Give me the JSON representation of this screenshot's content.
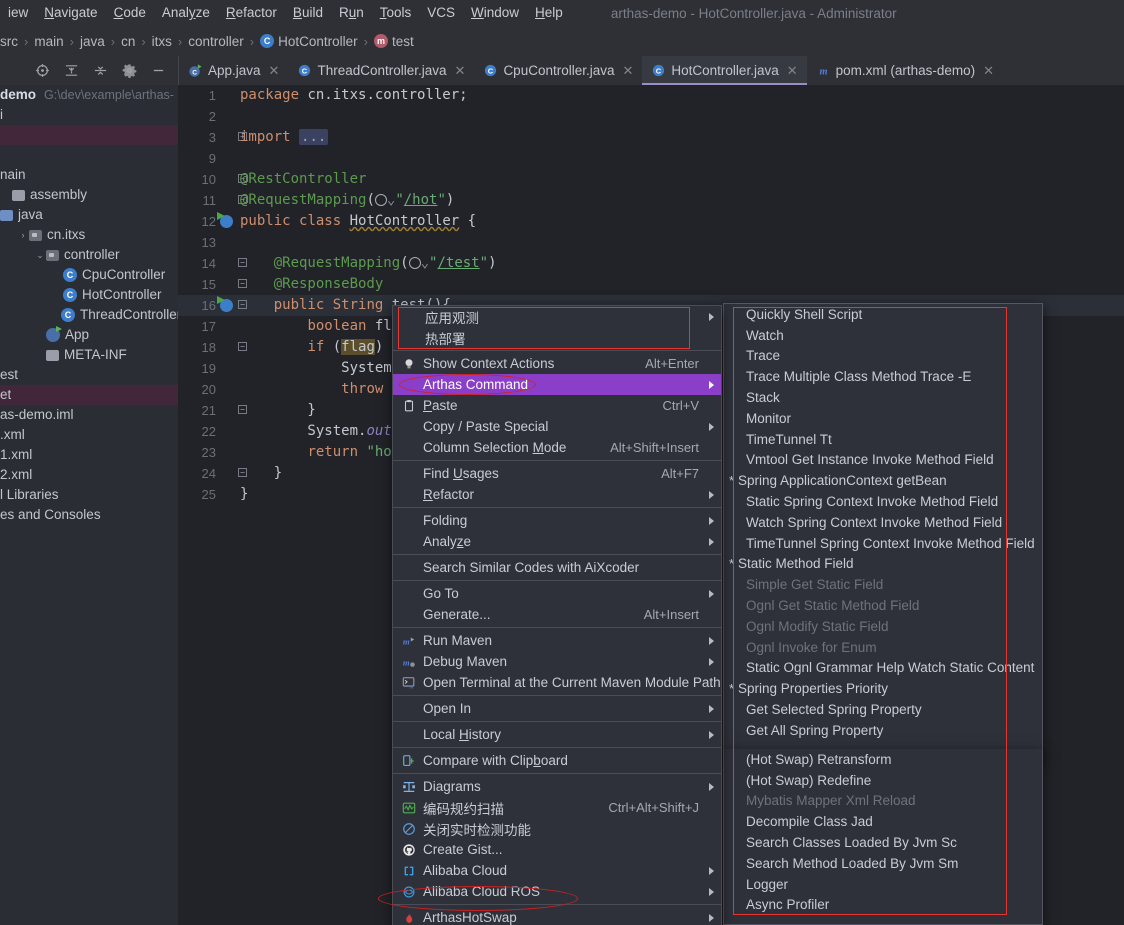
{
  "menubar": {
    "items": [
      "iew",
      "Navigate",
      "Code",
      "Analyze",
      "Refactor",
      "Build",
      "Run",
      "Tools",
      "VCS",
      "Window",
      "Help"
    ],
    "window_title": "arthas-demo - HotController.java - Administrator"
  },
  "breadcrumb": {
    "items": [
      {
        "label": "src",
        "icon": ""
      },
      {
        "label": "main",
        "icon": ""
      },
      {
        "label": "java",
        "icon": ""
      },
      {
        "label": "cn",
        "icon": ""
      },
      {
        "label": "itxs",
        "icon": ""
      },
      {
        "label": "controller",
        "icon": ""
      },
      {
        "label": "HotController",
        "icon": "class-icon"
      },
      {
        "label": "test",
        "icon": "method-icon"
      }
    ]
  },
  "toolbar": {
    "icons": [
      "locate-target-icon",
      "expand-all-icon",
      "collapse-all-icon",
      "settings-gear-icon",
      "hide-minus-icon"
    ]
  },
  "tabs": [
    {
      "label": "App.java",
      "icon": "app-run-icon",
      "active": false
    },
    {
      "label": "ThreadController.java",
      "icon": "class-icon",
      "active": false
    },
    {
      "label": "CpuController.java",
      "icon": "class-icon",
      "active": false
    },
    {
      "label": "HotController.java",
      "icon": "class-icon",
      "active": true
    },
    {
      "label": "pom.xml (arthas-demo)",
      "icon": "maven-icon",
      "active": false
    }
  ],
  "sidebar": {
    "rows": [
      {
        "label": "demo",
        "path": "G:\\dev\\example\\arthas-",
        "kind": "project",
        "bold": true,
        "indent": 0
      },
      {
        "label": "i",
        "kind": "text",
        "indent": 0
      },
      {
        "label": "",
        "kind": "blank-highlight",
        "indent": 0,
        "highlight": true
      },
      {
        "label": "",
        "kind": "blank",
        "indent": 0
      },
      {
        "label": "nain",
        "kind": "text",
        "indent": 0
      },
      {
        "label": "assembly",
        "kind": "folder",
        "indent": 0
      },
      {
        "label": "java",
        "kind": "source-folder",
        "indent": 0
      },
      {
        "label": "cn.itxs",
        "kind": "package",
        "indent": 1,
        "chevron": "right"
      },
      {
        "label": "controller",
        "kind": "package",
        "indent": 2,
        "chevron": "down"
      },
      {
        "label": "CpuController",
        "kind": "class",
        "indent": 3
      },
      {
        "label": "HotController",
        "kind": "class",
        "indent": 3
      },
      {
        "label": "ThreadController",
        "kind": "class",
        "indent": 3
      },
      {
        "label": "App",
        "kind": "app",
        "indent": 2
      },
      {
        "label": "META-INF",
        "kind": "folder",
        "indent": 2
      },
      {
        "label": "est",
        "kind": "text",
        "indent": 0
      },
      {
        "label": "et",
        "kind": "text",
        "indent": 0,
        "highlight": true
      },
      {
        "label": "as-demo.iml",
        "kind": "text",
        "indent": 0
      },
      {
        "label": ".xml",
        "kind": "text",
        "indent": 0
      },
      {
        "label": "1.xml",
        "kind": "text",
        "indent": 0
      },
      {
        "label": "2.xml",
        "kind": "text",
        "indent": 0
      },
      {
        "label": "l Libraries",
        "kind": "text",
        "indent": 0
      },
      {
        "label": "es and Consoles",
        "kind": "text",
        "indent": 0
      }
    ]
  },
  "editor": {
    "lines": [
      {
        "no": "1",
        "html": "<span class='kw'>package</span> cn.itxs.controller;"
      },
      {
        "no": "2",
        "html": ""
      },
      {
        "no": "3",
        "html": "<span class='kw'>import</span> <span class='fld-ph'>...</span>",
        "fold": "+"
      },
      {
        "no": "9",
        "html": ""
      },
      {
        "no": "10",
        "html": "<span class='ann'>@RestController</span>",
        "fold": "-"
      },
      {
        "no": "11",
        "html": "<span class='ann'>@RequestMapping</span>(<span class='globe-slot'></span><span class='str'>\"</span><span class='lnk'>/hot</span><span class='str'>\"</span>)",
        "fold": "-"
      },
      {
        "no": "12",
        "html": "<span class='kw'>public</span> <span class='kw'>class</span> <span class='cls-und'>HotController</span> {",
        "gutter": "run-icon"
      },
      {
        "no": "13",
        "html": ""
      },
      {
        "no": "14",
        "html": "    <span class='ann'>@RequestMapping</span>(<span class='globe-slot'></span><span class='str'>\"</span><span class='lnk'>/test</span><span class='str'>\"</span>)",
        "fold": "-"
      },
      {
        "no": "15",
        "html": "    <span class='ann'>@ResponseBody</span>",
        "fold": "-"
      },
      {
        "no": "16",
        "html": "    <span class='kw'>public</span> <span class='kw'>String</span> <span class='mname'>test</span>(){",
        "gutter": "run-icon",
        "fold": "-",
        "current": true
      },
      {
        "no": "17",
        "html": "        <span class='kw'>boolean</span> fla"
      },
      {
        "no": "18",
        "html": "        <span class='kw'>if</span> (<span class='hlword'>flag</span>) {",
        "fold": "-"
      },
      {
        "no": "19",
        "html": "            System."
      },
      {
        "no": "20",
        "html": "            <span class='kw'>throw</span> n"
      },
      {
        "no": "21",
        "html": "        }",
        "fold": "-"
      },
      {
        "no": "22",
        "html": "        System.<span class='ital'>out</span>."
      },
      {
        "no": "23",
        "html": "        <span class='kw'>return</span> <span class='str'>\"hot</span>"
      },
      {
        "no": "24",
        "html": "    }",
        "fold": "-"
      },
      {
        "no": "25",
        "html": "}"
      }
    ]
  },
  "context_menu": {
    "items": [
      {
        "label": "应用观测",
        "submenu": true,
        "chinese": true
      },
      {
        "label": "热部署",
        "chinese": true
      },
      {
        "sep": true
      },
      {
        "label": "Show Context Actions",
        "shortcut": "Alt+Enter",
        "icon": "lightbulb-icon"
      },
      {
        "label": "Arthas Command",
        "submenu": true,
        "selected": true
      },
      {
        "label": "Paste",
        "shortcut": "Ctrl+V",
        "icon": "clipboard-icon",
        "mnemonic": "P"
      },
      {
        "label": "Copy / Paste Special",
        "submenu": true
      },
      {
        "label": "Column Selection Mode",
        "shortcut": "Alt+Shift+Insert",
        "mnemonic": "M"
      },
      {
        "sep": true
      },
      {
        "label": "Find Usages",
        "shortcut": "Alt+F7",
        "mnemonic": "U"
      },
      {
        "label": "Refactor",
        "submenu": true,
        "mnemonic": "R"
      },
      {
        "sep": true
      },
      {
        "label": "Folding",
        "submenu": true
      },
      {
        "label": "Analyze",
        "submenu": true,
        "mnemonic": "z"
      },
      {
        "sep": true
      },
      {
        "label": "Search Similar Codes with AiXcoder"
      },
      {
        "sep": true
      },
      {
        "label": "Go To",
        "submenu": true
      },
      {
        "label": "Generate...",
        "shortcut": "Alt+Insert"
      },
      {
        "sep": true
      },
      {
        "label": "Run Maven",
        "submenu": true,
        "icon": "maven-run-icon"
      },
      {
        "label": "Debug Maven",
        "submenu": true,
        "icon": "maven-debug-icon"
      },
      {
        "label": "Open Terminal at the Current Maven Module Path",
        "icon": "terminal-icon"
      },
      {
        "sep": true
      },
      {
        "label": "Open In",
        "submenu": true
      },
      {
        "sep": true
      },
      {
        "label": "Local History",
        "submenu": true,
        "mnemonic": "H"
      },
      {
        "sep": true
      },
      {
        "label": "Compare with Clipboard",
        "icon": "compare-icon",
        "mnemonic": "b"
      },
      {
        "sep": true
      },
      {
        "label": "Diagrams",
        "submenu": true,
        "icon": "diagram-icon"
      },
      {
        "label": "编码规约扫描",
        "shortcut": "Ctrl+Alt+Shift+J",
        "icon": "scan-icon"
      },
      {
        "label": "关闭实时检测功能",
        "icon": "disable-icon"
      },
      {
        "label": "Create Gist...",
        "icon": "github-icon"
      },
      {
        "label": "Alibaba Cloud",
        "submenu": true,
        "icon": "alicloud-icon"
      },
      {
        "label": "Alibaba Cloud ROS",
        "submenu": true,
        "icon": "alicloud-ros-icon"
      },
      {
        "sep": true
      },
      {
        "label": "ArthasHotSwap",
        "submenu": true,
        "icon": "flame-icon"
      }
    ]
  },
  "submenu": {
    "group1": [
      {
        "label": "Quickly Shell Script"
      },
      {
        "label": "Watch"
      },
      {
        "label": "Trace"
      },
      {
        "label": "Trace Multiple Class Method Trace -E"
      },
      {
        "label": "Stack"
      },
      {
        "label": "Monitor"
      },
      {
        "label": "TimeTunnel Tt"
      },
      {
        "label": "Vmtool Get Instance Invoke Method Field"
      },
      {
        "label": "Spring ApplicationContext getBean",
        "header": true,
        "star": "*"
      },
      {
        "label": "Static Spring Context Invoke  Method Field"
      },
      {
        "label": "Watch Spring Context Invoke Method Field"
      },
      {
        "label": "TimeTunnel Spring Context Invoke Method Field"
      },
      {
        "label": "Static Method Field",
        "header": true,
        "star": "*"
      },
      {
        "label": "Simple Get Static Field",
        "disabled": true
      },
      {
        "label": "Ognl Get Static Method Field",
        "disabled": true
      },
      {
        "label": "Ognl Modify Static Field",
        "disabled": true
      },
      {
        "label": "Ognl Invoke for Enum",
        "disabled": true
      },
      {
        "label": "Static Ognl Grammar Help Watch Static Content"
      },
      {
        "label": "Spring Properties Priority",
        "header": true,
        "star": "*"
      },
      {
        "label": "Get Selected Spring Property"
      },
      {
        "label": "Get All Spring Property"
      }
    ],
    "group2": [
      {
        "label": "(Hot Swap) Retransform"
      },
      {
        "label": "(Hot Swap) Redefine"
      },
      {
        "label": "Mybatis Mapper Xml Reload",
        "disabled": true
      },
      {
        "label": "Decompile Class Jad"
      },
      {
        "label": "Search Classes Loaded By Jvm Sc"
      },
      {
        "label": "Search Method Loaded By Jvm Sm"
      },
      {
        "label": "Logger"
      },
      {
        "label": "Async Profiler"
      }
    ]
  },
  "colors": {
    "selection_purple": "#8b3fc9",
    "annotation_red": "#e5372f",
    "editor_bg": "#212328",
    "panel_bg": "#2f313a",
    "keyword": "#cf8e6d",
    "annotation_green": "#5d9a4f",
    "string_green": "#6aab73"
  }
}
